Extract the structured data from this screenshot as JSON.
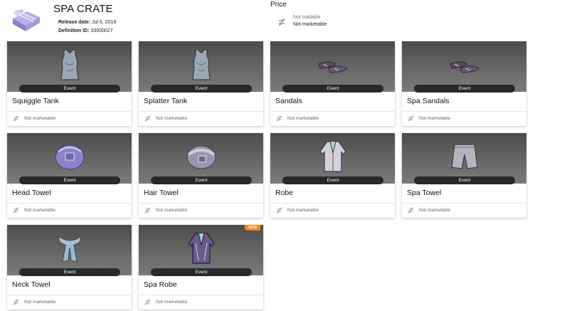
{
  "header": {
    "title": "SPA CRATE",
    "release_label": "Release date:",
    "release_value": "Jul 6, 2018",
    "definition_label": "Definition ID:",
    "definition_value": "33000027",
    "crate_icon": "gift-box-icon"
  },
  "price": {
    "label": "Price",
    "icon": "not-marketable-icon",
    "line1": "Not tradable",
    "line2": "Not marketable"
  },
  "colors": {
    "badge_bg": "#262a2c",
    "art_bg": "#5a5a5a",
    "new_tag": "#f08a1e",
    "item_purple": "#7b6fa8"
  },
  "items": [
    {
      "name": "Squiggle Tank",
      "badge": "Event",
      "status": "Not marketable",
      "icon": "tank-top-icon"
    },
    {
      "name": "Splatter Tank",
      "badge": "Event",
      "status": "Not marketable",
      "icon": "tank-top-icon"
    },
    {
      "name": "Sandals",
      "badge": "Event",
      "status": "Not marketable",
      "icon": "sandals-icon"
    },
    {
      "name": "Spa Sandals",
      "badge": "Event",
      "status": "Not marketable",
      "icon": "sandals-icon"
    },
    {
      "name": "Head Towel",
      "badge": "Event",
      "status": "Not marketable",
      "icon": "head-towel-icon"
    },
    {
      "name": "Hair Towel",
      "badge": "Event",
      "status": "Not marketable",
      "icon": "hair-towel-icon"
    },
    {
      "name": "Robe",
      "badge": "Event",
      "status": "Not marketable",
      "icon": "robe-icon"
    },
    {
      "name": "Spa Towel",
      "badge": "Event",
      "status": "Not marketable",
      "icon": "shorts-towel-icon"
    },
    {
      "name": "Neck Towel",
      "badge": "Event",
      "status": "Not marketable",
      "icon": "neck-towel-icon"
    },
    {
      "name": "Spa Robe",
      "badge": "Event",
      "status": "Not marketable",
      "icon": "robe-icon",
      "new_label": "NEW"
    }
  ]
}
